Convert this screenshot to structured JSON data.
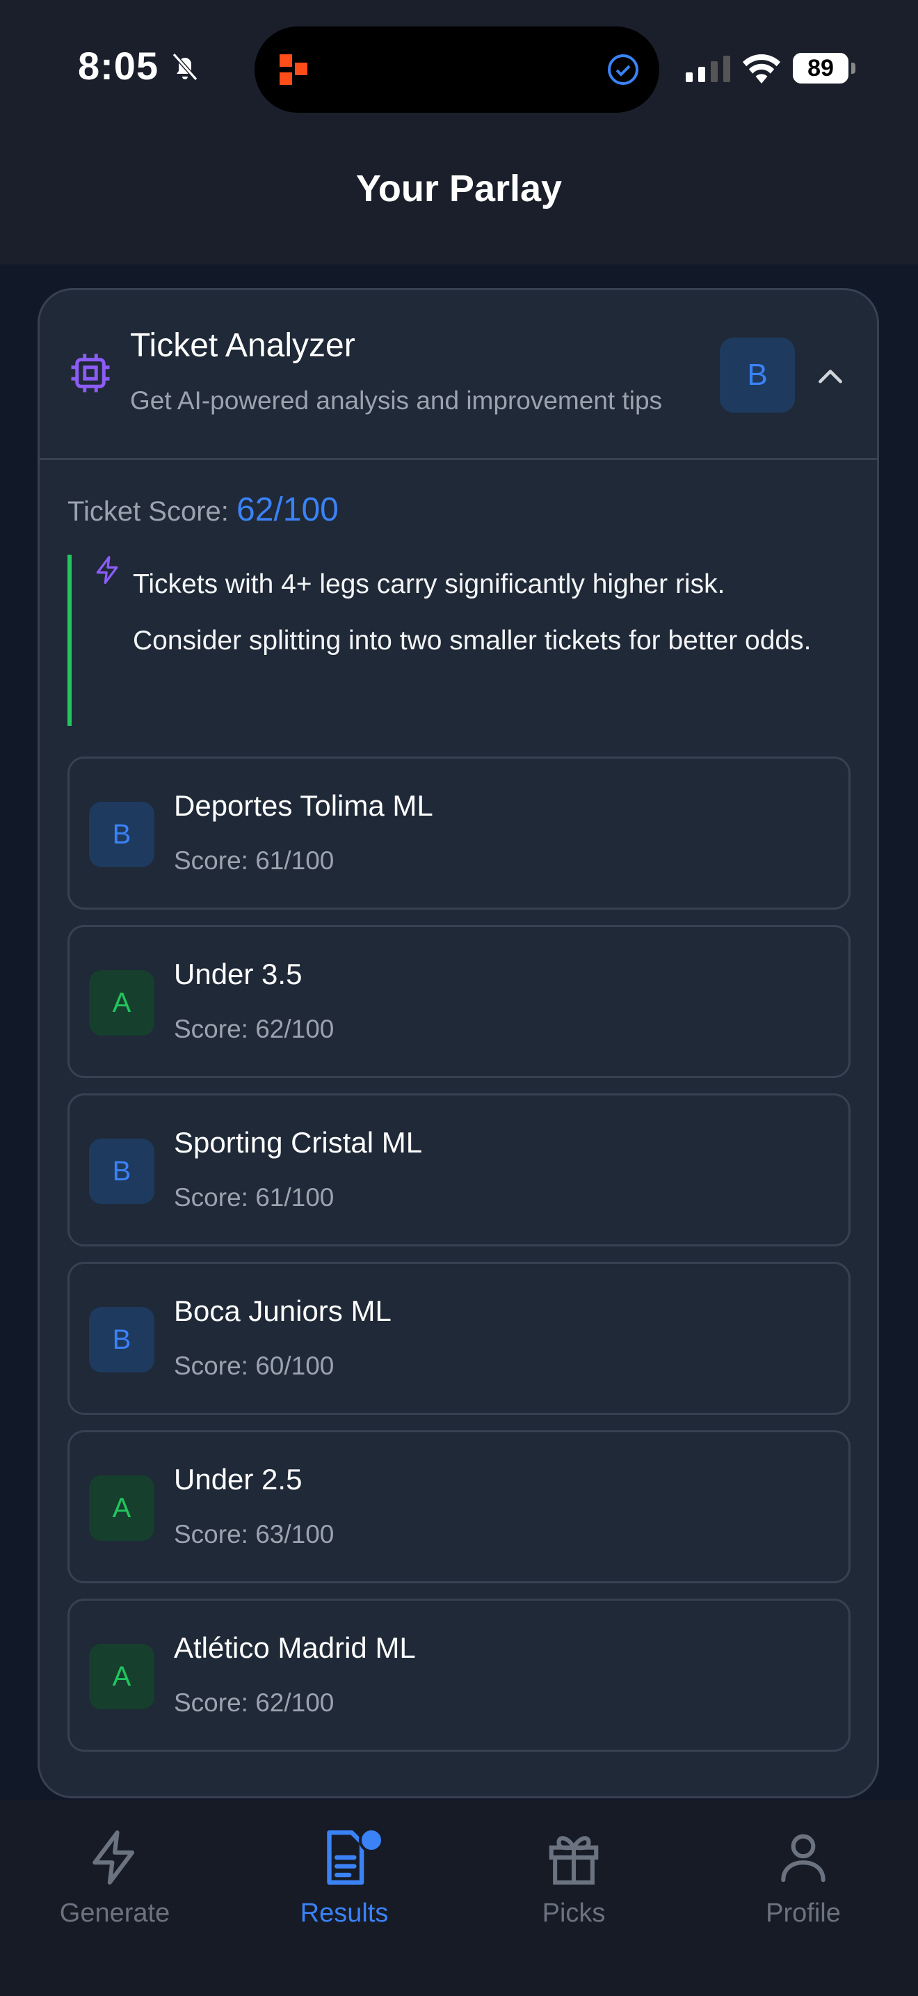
{
  "status_bar": {
    "time": "8:05",
    "battery": "89"
  },
  "header": {
    "title": "Your Parlay"
  },
  "analyzer": {
    "title": "Ticket Analyzer",
    "subtitle": "Get AI-powered analysis and improvement tips",
    "grade": "B",
    "score_label": "Ticket Score:",
    "score_value": "62/100",
    "tip": "Tickets with 4+ legs carry significantly higher risk. Consider splitting into two smaller tickets for better odds."
  },
  "legs": [
    {
      "grade": "B",
      "name": "Deportes Tolima ML",
      "score": "Score: 61/100"
    },
    {
      "grade": "A",
      "name": "Under 3.5",
      "score": "Score: 62/100"
    },
    {
      "grade": "B",
      "name": "Sporting Cristal ML",
      "score": "Score: 61/100"
    },
    {
      "grade": "B",
      "name": "Boca Juniors ML",
      "score": "Score: 60/100"
    },
    {
      "grade": "A",
      "name": "Under 2.5",
      "score": "Score: 63/100"
    },
    {
      "grade": "A",
      "name": "Atlético Madrid ML",
      "score": "Score: 62/100"
    }
  ],
  "tabs": [
    {
      "label": "Generate",
      "icon": "bolt-icon"
    },
    {
      "label": "Results",
      "icon": "document-icon"
    },
    {
      "label": "Picks",
      "icon": "gift-icon"
    },
    {
      "label": "Profile",
      "icon": "person-icon"
    }
  ],
  "colors": {
    "accent": "#3b82f6",
    "grade_a": "#22c55e",
    "tip_border": "#22c55e",
    "icon_purple": "#8b5cf6"
  }
}
